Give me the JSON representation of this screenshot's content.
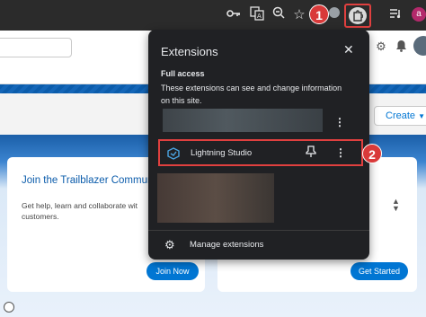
{
  "toolbar": {
    "icons": [
      "key-icon",
      "translate-icon",
      "zoom-out-icon",
      "star-icon",
      "extension-badge-icon",
      "extensions-puzzle-icon",
      "reading-list-icon",
      "profile-avatar"
    ],
    "avatar_letter": "a"
  },
  "callouts": {
    "one": "1",
    "two": "2"
  },
  "extensions_panel": {
    "title": "Extensions",
    "full_access_title": "Full access",
    "full_access_desc": "These extensions can see and change information on this site.",
    "extension_name": "Lightning Studio",
    "manage_label": "Manage extensions"
  },
  "page": {
    "create_button": "Create",
    "card1_title": "Join the Trailblazer Commun",
    "card1_text": "Get help, learn and collaborate wit customers.",
    "card1_button": "Join Now",
    "card2_button": "Get Started"
  },
  "colors": {
    "callout_red": "#d93a3a",
    "highlight_border": "#e0403f",
    "panel_bg": "#202124",
    "brand_blue": "#0176d3"
  }
}
